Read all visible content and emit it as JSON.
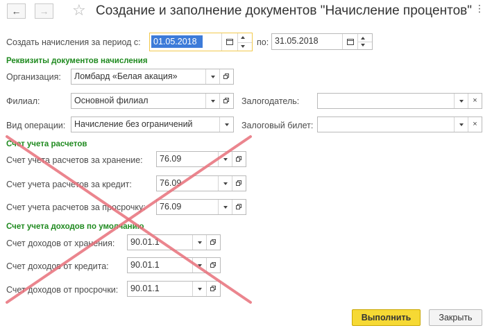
{
  "window": {
    "title": "Создание и заполнение документов \"Начисление процентов\""
  },
  "period": {
    "label": "Создать начисления за период с:",
    "from_value": "01.05.2018",
    "to_label": "по:",
    "to_value": "31.05.2018"
  },
  "requisites": {
    "section_title": "Реквизиты документов начисления",
    "organization_label": "Организация:",
    "organization_value": "Ломбард «Белая акация»",
    "branch_label": "Филиал:",
    "branch_value": "Основной филиал",
    "operation_label": "Вид операции:",
    "operation_value": "Начисление без ограничений",
    "pledger_label": "Залогодатель:",
    "pledger_value": "",
    "ticket_label": "Залоговый билет:",
    "ticket_value": ""
  },
  "settlements": {
    "section_title": "Счет учета расчетов",
    "storage_label": "Счет учета расчетов за хранение:",
    "storage_value": "76.09",
    "credit_label": "Счет учета расчетов за кредит:",
    "credit_value": "76.09",
    "overdue_label": "Счет учета расчетов за просрочку:",
    "overdue_value": "76.09"
  },
  "income": {
    "section_title": "Счет учета доходов по умолчанию",
    "storage_label": "Счет доходов от хранения:",
    "storage_value": "90.01.1",
    "credit_label": "Счет доходов от кредита:",
    "credit_value": "90.01.1",
    "overdue_label": "Счет доходов от просрочки:",
    "overdue_value": "90.01.1"
  },
  "footer": {
    "execute_label": "Выполнить",
    "close_label": "Закрыть"
  },
  "colors": {
    "section": "#1f8a1f",
    "primary_button": "#f6d934",
    "focus_border": "#f2c94c",
    "selection": "#3d7bd9",
    "cross": "#e8707a"
  }
}
